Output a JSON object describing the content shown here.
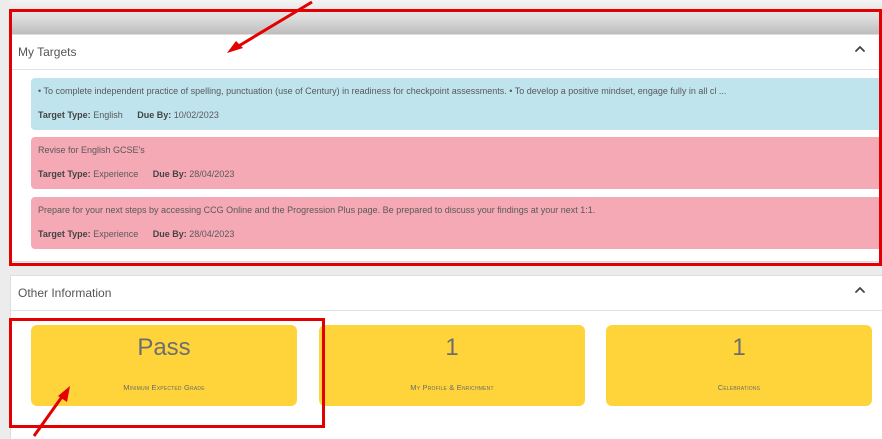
{
  "targets_panel": {
    "title": "My Targets",
    "targets": [
      {
        "description": "• To complete independent practice of spelling, punctuation (use of Century) in readiness for checkpoint assessments. • To develop a positive mindset, engage fully in all cl ...",
        "type_label": "Target Type:",
        "type": "English",
        "due_label": "Due By:",
        "due": "10/02/2023",
        "color": "#bfe4ee"
      },
      {
        "description": "Revise for English GCSE's",
        "type_label": "Target Type:",
        "type": "Experience",
        "due_label": "Due By:",
        "due": "28/04/2023",
        "color": "#f4a9b5"
      },
      {
        "description": "Prepare for your next steps by accessing CCG Online and the Progression Plus page. Be prepared to discuss your findings at your next 1:1.",
        "type_label": "Target Type:",
        "type": "Experience",
        "due_label": "Due By:",
        "due": "28/04/2023",
        "color": "#f4a9b5"
      }
    ]
  },
  "other_panel": {
    "title": "Other Information",
    "cards": [
      {
        "value": "Pass",
        "label": "Minimum Expected Grade"
      },
      {
        "value": "1",
        "label": "My Profile & Enrichment"
      },
      {
        "value": "1",
        "label": "Celebrations"
      }
    ]
  },
  "icons": {
    "collapse": "chevron-up-icon"
  },
  "colors": {
    "card_yellow": "#ffd43b",
    "annotation_red": "#e20000"
  }
}
